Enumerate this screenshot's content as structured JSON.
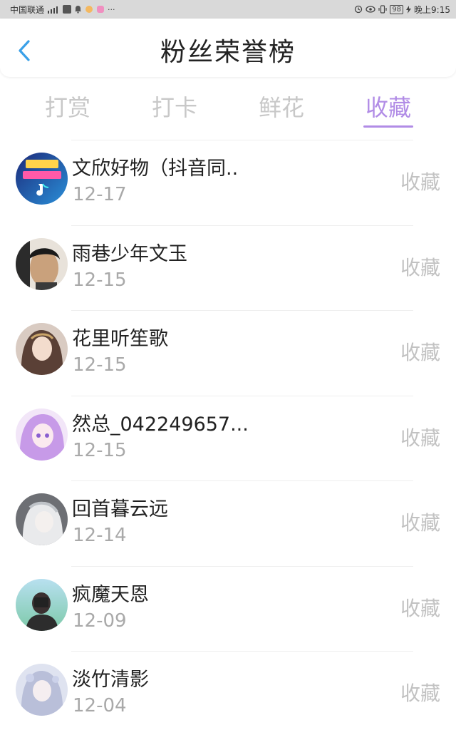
{
  "status_bar": {
    "carrier": "中国联通",
    "battery": "98",
    "time": "晚上9:15"
  },
  "header": {
    "title": "粉丝荣誉榜",
    "back_icon": "chevron-left-icon"
  },
  "tabs": [
    {
      "label": "打赏",
      "active": false
    },
    {
      "label": "打卡",
      "active": false
    },
    {
      "label": "鲜花",
      "active": false
    },
    {
      "label": "收藏",
      "active": true
    }
  ],
  "colors": {
    "accent": "#b18ce6",
    "back_icon": "#3aa0e8"
  },
  "fans": [
    {
      "name": "文欣好物（抖音同..",
      "date": "12-17",
      "action": "收藏",
      "avatar": "logo-avatar"
    },
    {
      "name": "雨巷少年文玉",
      "date": "12-15",
      "action": "收藏",
      "avatar": "photo-avatar"
    },
    {
      "name": "花里听笙歌",
      "date": "12-15",
      "action": "收藏",
      "avatar": "anime-avatar"
    },
    {
      "name": "然总_042249657...",
      "date": "12-15",
      "action": "收藏",
      "avatar": "anime-avatar"
    },
    {
      "name": "回首暮云远",
      "date": "12-14",
      "action": "收藏",
      "avatar": "anime-avatar"
    },
    {
      "name": "疯魔天恩",
      "date": "12-09",
      "action": "收藏",
      "avatar": "photo-avatar"
    },
    {
      "name": "淡竹清影",
      "date": "12-04",
      "action": "收藏",
      "avatar": "anime-avatar"
    }
  ]
}
